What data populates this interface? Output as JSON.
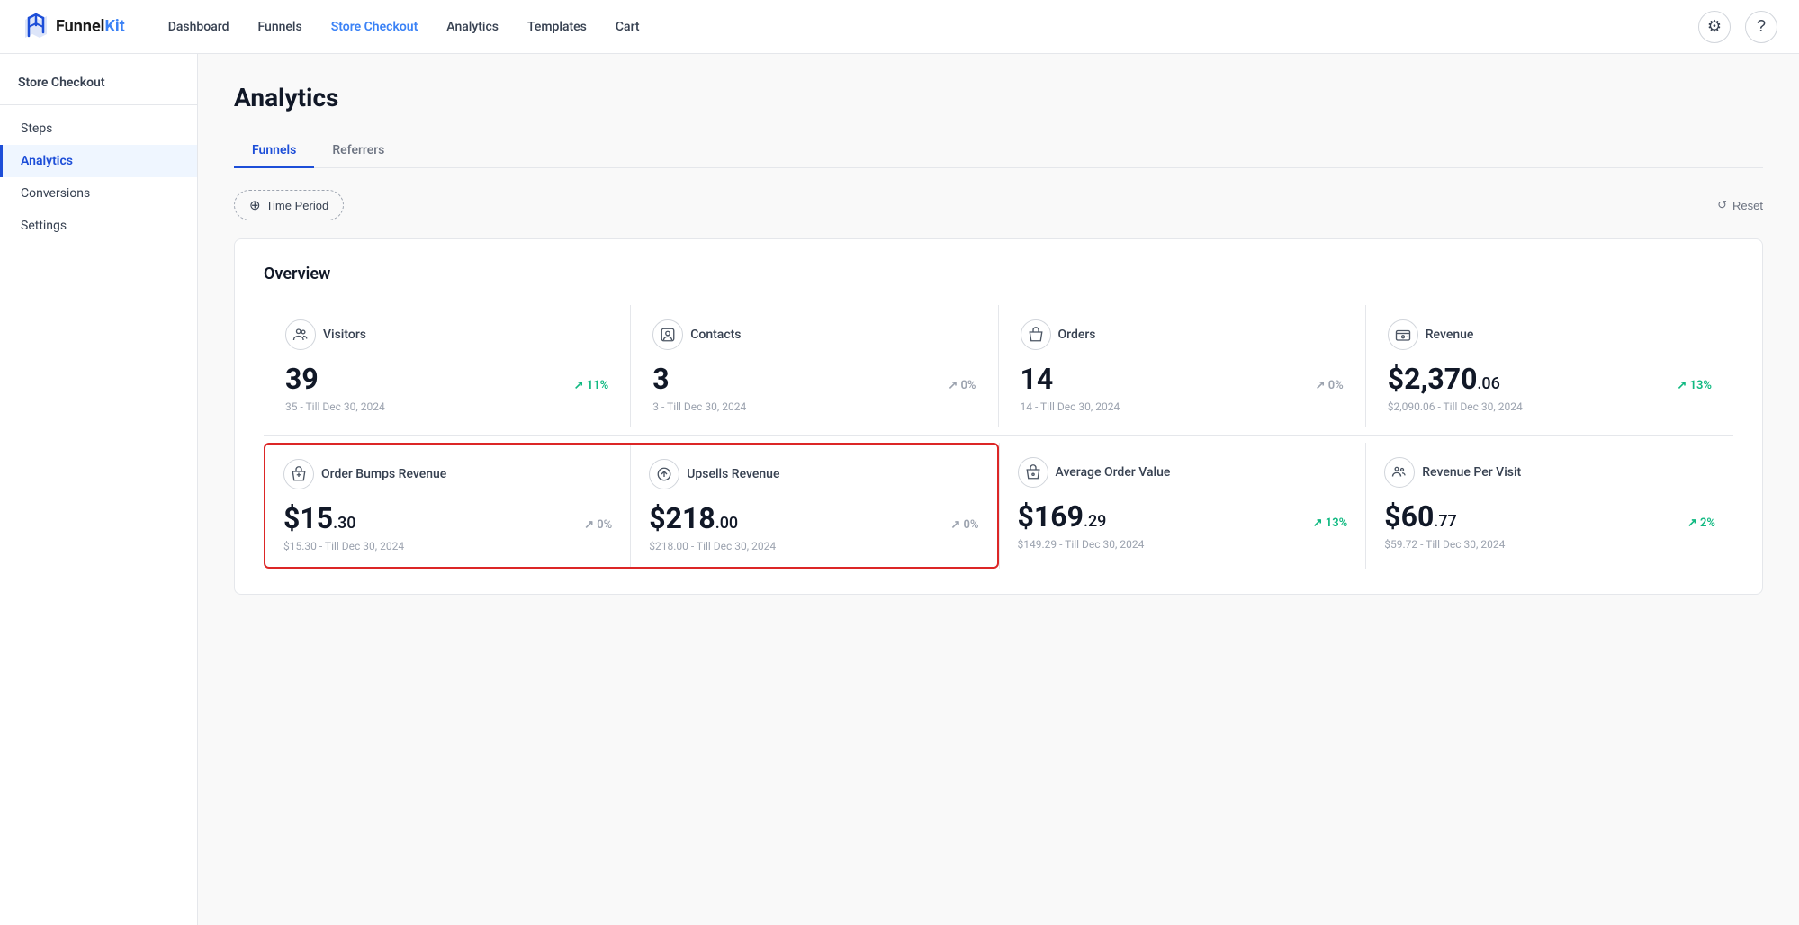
{
  "brand": {
    "name_part1": "Funnel",
    "name_part2": "Kit"
  },
  "topnav": {
    "links": [
      {
        "label": "Dashboard",
        "active": false,
        "key": "dashboard"
      },
      {
        "label": "Funnels",
        "active": false,
        "key": "funnels"
      },
      {
        "label": "Store Checkout",
        "active": true,
        "key": "store-checkout"
      },
      {
        "label": "Analytics",
        "active": false,
        "key": "analytics"
      },
      {
        "label": "Templates",
        "active": false,
        "key": "templates"
      },
      {
        "label": "Cart",
        "active": false,
        "key": "cart"
      }
    ]
  },
  "sidebar": {
    "context_label": "Store Checkout",
    "items": [
      {
        "label": "Steps",
        "active": false,
        "key": "steps"
      },
      {
        "label": "Analytics",
        "active": true,
        "key": "analytics"
      },
      {
        "label": "Conversions",
        "active": false,
        "key": "conversions"
      },
      {
        "label": "Settings",
        "active": false,
        "key": "settings"
      }
    ]
  },
  "main": {
    "page_title": "Analytics",
    "tabs": [
      {
        "label": "Funnels",
        "active": true
      },
      {
        "label": "Referrers",
        "active": false
      }
    ],
    "filter": {
      "time_period_label": "Time Period",
      "reset_label": "Reset"
    },
    "overview": {
      "title": "Overview",
      "row1": [
        {
          "key": "visitors",
          "icon": "👥",
          "label": "Visitors",
          "value": "39",
          "cents": null,
          "trend": "↗ 11%",
          "trend_type": "up",
          "subtitle": "35 - Till Dec 30, 2024"
        },
        {
          "key": "contacts",
          "icon": "👤",
          "label": "Contacts",
          "value": "3",
          "cents": null,
          "trend": "↗ 0%",
          "trend_type": "neutral",
          "subtitle": "3 - Till Dec 30, 2024"
        },
        {
          "key": "orders",
          "icon": "📦",
          "label": "Orders",
          "value": "14",
          "cents": null,
          "trend": "↗ 0%",
          "trend_type": "neutral",
          "subtitle": "14 - Till Dec 30, 2024"
        },
        {
          "key": "revenue",
          "icon": "💲",
          "label": "Revenue",
          "value": "$2,370",
          "cents": ".06",
          "trend": "↗ 13%",
          "trend_type": "up",
          "subtitle": "$2,090.06 - Till Dec 30, 2024"
        }
      ],
      "row2_left": [
        {
          "key": "order-bumps-revenue",
          "icon": "🛍",
          "label": "Order Bumps Revenue",
          "value": "$15",
          "cents": ".30",
          "trend": "↗ 0%",
          "trend_type": "neutral",
          "subtitle": "$15.30 - Till Dec 30, 2024"
        },
        {
          "key": "upsells-revenue",
          "icon": "↗",
          "label": "Upsells Revenue",
          "value": "$218",
          "cents": ".00",
          "trend": "↗ 0%",
          "trend_type": "neutral",
          "subtitle": "$218.00 - Till Dec 30, 2024"
        }
      ],
      "row2_right": [
        {
          "key": "average-order-value",
          "icon": "🏷",
          "label": "Average Order Value",
          "value": "$169",
          "cents": ".29",
          "trend": "↗ 13%",
          "trend_type": "up",
          "subtitle": "$149.29 - Till Dec 30, 2024"
        },
        {
          "key": "revenue-per-visit",
          "icon": "👥",
          "label": "Revenue Per Visit",
          "value": "$60",
          "cents": ".77",
          "trend": "↗ 2%",
          "trend_type": "up",
          "subtitle": "$59.72 - Till Dec 30, 2024"
        }
      ]
    }
  }
}
